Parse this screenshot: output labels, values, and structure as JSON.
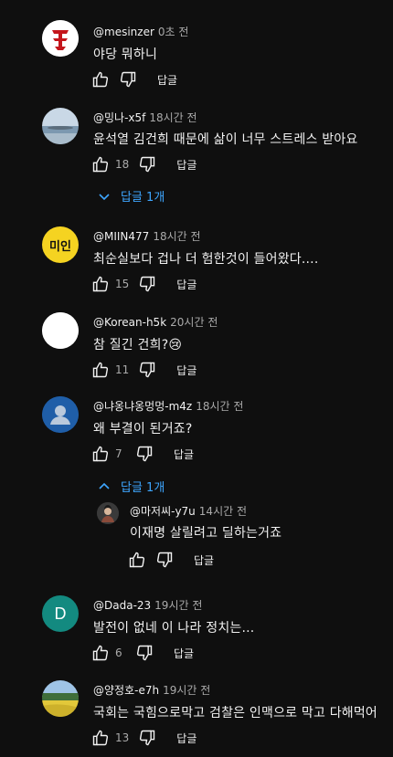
{
  "comments": [
    {
      "author": "@mesinzer",
      "time": "0초 전",
      "text": "야당 뭐하니",
      "likes": "",
      "reply_label": "답글",
      "avatar_icon": "red-emblem-avatar"
    },
    {
      "author": "@밍나-x5f",
      "time": "18시간 전",
      "text": "윤석열 김건희 때문에 삶이 너무 스트레스 받아요",
      "likes": "18",
      "reply_label": "답글",
      "avatar_icon": "landscape-photo-avatar",
      "replies_toggle": "답글 1개"
    },
    {
      "author": "@MIIN477",
      "time": "18시간 전",
      "text": "최순실보다 겁나 더 험한것이 들어왔다....",
      "likes": "15",
      "reply_label": "답글",
      "avatar_icon": "yellow-text-avatar",
      "avatar_text": "미인"
    },
    {
      "author": "@Korean-h5k",
      "time": "20시간 전",
      "text": "참 질긴 건희?😢",
      "likes": "11",
      "reply_label": "답글",
      "avatar_icon": "white-circle-avatar"
    },
    {
      "author": "@냐옹냐옹멍멍-m4z",
      "time": "18시간 전",
      "text": "왜 부결이 된거죠?",
      "likes": "7",
      "reply_label": "답글",
      "avatar_icon": "default-person-avatar",
      "replies_toggle": "답글 1개"
    },
    {
      "author": "@마저씨-y7u",
      "time": "14시간 전",
      "text": "이재명 살릴려고 딜하는거죠",
      "likes": "",
      "reply_label": "답글",
      "avatar_icon": "photo-avatar"
    },
    {
      "author": "@Dada-23",
      "time": "19시간 전",
      "text": "발전이 없네 이 나라 정치는...",
      "likes": "6",
      "reply_label": "답글",
      "avatar_icon": "letter-avatar",
      "avatar_text": "D"
    },
    {
      "author": "@양정호-e7h",
      "time": "19시간 전",
      "text": "국회는 국힘으로막고 검찰은 인맥으로 막고 다해먹어",
      "likes": "13",
      "reply_label": "답글",
      "avatar_icon": "field-photo-avatar"
    }
  ],
  "colors": {
    "background": "#0f0f0f",
    "link": "#3ea6ff",
    "secondary": "#aaaaaa"
  }
}
